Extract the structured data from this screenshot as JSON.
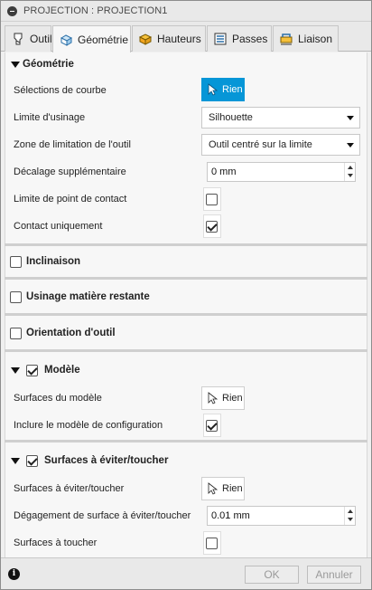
{
  "window": {
    "title": "PROJECTION : PROJECTION1"
  },
  "tabs": [
    {
      "label": "Outil"
    },
    {
      "label": "Géométrie"
    },
    {
      "label": "Hauteurs"
    },
    {
      "label": "Passes"
    },
    {
      "label": "Liaison"
    }
  ],
  "geometry": {
    "title": "Géométrie",
    "curve_selections": {
      "label": "Sélections de courbe",
      "button": "Rien"
    },
    "machining_limit": {
      "label": "Limite d'usinage",
      "value": "Silhouette"
    },
    "tool_containment": {
      "label": "Zone de limitation de l'outil",
      "value": "Outil centré sur la limite"
    },
    "additional_offset": {
      "label": "Décalage supplémentaire",
      "value": "0 mm"
    },
    "contact_point_limit": {
      "label": "Limite de point de contact",
      "checked": false
    },
    "contact_only": {
      "label": "Contact uniquement",
      "checked": true
    }
  },
  "sections": {
    "tilt": {
      "title": "Inclinaison",
      "checked": false
    },
    "rest_machining": {
      "title": "Usinage matière restante",
      "checked": false
    },
    "tool_orientation": {
      "title": "Orientation d'outil",
      "checked": false
    }
  },
  "model": {
    "title": "Modèle",
    "checked": true,
    "model_surfaces": {
      "label": "Surfaces du modèle",
      "button": "Rien"
    },
    "include_setup_model": {
      "label": "Inclure le modèle de configuration",
      "checked": true
    }
  },
  "avoid_touch": {
    "title": "Surfaces à éviter/toucher",
    "checked": true,
    "surfaces": {
      "label": "Surfaces à éviter/toucher",
      "button": "Rien"
    },
    "clearance": {
      "label": "Dégagement de surface à éviter/toucher",
      "value": "0.01 mm"
    },
    "touch_surfaces": {
      "label": "Surfaces à toucher",
      "checked": false
    }
  },
  "footer": {
    "ok": "OK",
    "cancel": "Annuler"
  },
  "colors": {
    "accent_blue": "#0696d7",
    "panel_bg": "#f7f7f7",
    "chrome_bg": "#e9e9e9"
  },
  "icons": [
    "minimize-icon",
    "tool-tab-icon",
    "geometry-tab-icon",
    "heights-tab-icon",
    "passes-tab-icon",
    "linking-tab-icon",
    "select-cursor-icon",
    "info-icon"
  ]
}
